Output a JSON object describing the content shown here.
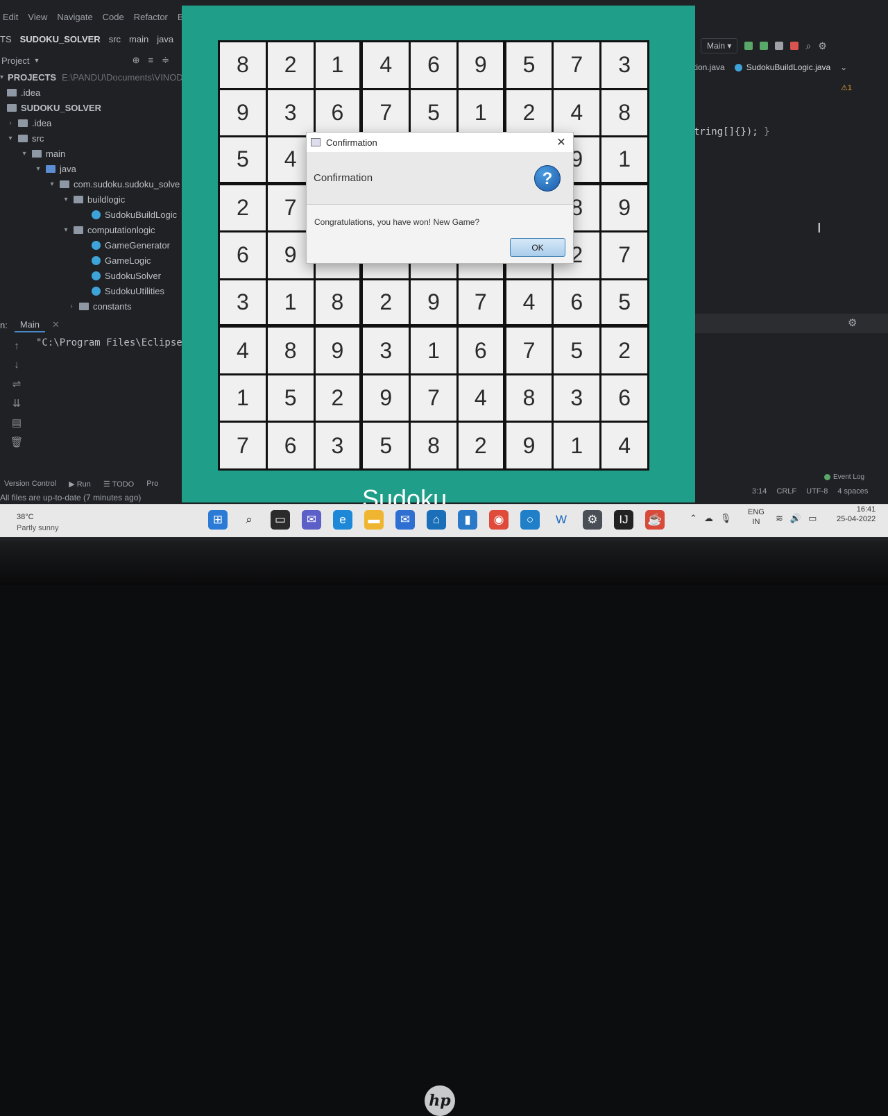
{
  "ide": {
    "menu": [
      "Edit",
      "View",
      "Navigate",
      "Code",
      "Refactor",
      "B"
    ],
    "breadcrumbs": [
      "TS",
      "SUDOKU_SOLVER",
      "src",
      "main",
      "java"
    ],
    "project_header": "Project",
    "tree": [
      {
        "label": "PROJECTS",
        "extra": "E:\\PANDU\\Documents\\VINOD_",
        "type": "root"
      },
      {
        "label": ".idea",
        "type": "folder"
      },
      {
        "label": "SUDOKU_SOLVER",
        "type": "folder"
      },
      {
        "label": ".idea",
        "type": "folder"
      },
      {
        "label": "src",
        "type": "folder"
      },
      {
        "label": "main",
        "type": "folder"
      },
      {
        "label": "java",
        "type": "folder-blue"
      },
      {
        "label": "com.sudoku.sudoku_solve",
        "type": "package"
      },
      {
        "label": "buildlogic",
        "type": "package"
      },
      {
        "label": "SudokuBuildLogic",
        "type": "class"
      },
      {
        "label": "computationlogic",
        "type": "package"
      },
      {
        "label": "GameGenerator",
        "type": "class"
      },
      {
        "label": "GameLogic",
        "type": "class"
      },
      {
        "label": "SudokuSolver",
        "type": "class"
      },
      {
        "label": "SudokuUtilities",
        "type": "class"
      },
      {
        "label": "constants",
        "type": "package"
      }
    ],
    "run_label": "n:",
    "run_tab": "Main",
    "console_text": "\"C:\\Program Files\\Eclipse",
    "bottom_tabs": [
      "Version Control",
      "Run",
      "TODO",
      "Pro"
    ],
    "status_left": "All files are up-to-date (7 minutes ago)",
    "run_config": "Main",
    "editor_tabs": [
      "tion.java",
      "SudokuBuildLogic.java"
    ],
    "warning_count": "1",
    "code_text": "tring[]{});",
    "code_brace": "}",
    "event_log": "Event Log",
    "status_right": [
      "3:14",
      "CRLF",
      "UTF-8",
      "4 spaces"
    ]
  },
  "sudoku": {
    "title": "Sudoku",
    "grid": [
      [
        "8",
        "2",
        "1",
        "4",
        "6",
        "9",
        "5",
        "7",
        "3"
      ],
      [
        "9",
        "3",
        "6",
        "7",
        "5",
        "1",
        "2",
        "4",
        "8"
      ],
      [
        "5",
        "4",
        "",
        "",
        "",
        "",
        "",
        "9",
        "1"
      ],
      [
        "2",
        "7",
        "",
        "",
        "",
        "",
        "",
        "8",
        "9"
      ],
      [
        "6",
        "9",
        "",
        "",
        "",
        "",
        "",
        "2",
        "7"
      ],
      [
        "3",
        "1",
        "8",
        "2",
        "9",
        "7",
        "4",
        "6",
        "5"
      ],
      [
        "4",
        "8",
        "9",
        "3",
        "1",
        "6",
        "7",
        "5",
        "2"
      ],
      [
        "1",
        "5",
        "2",
        "9",
        "7",
        "4",
        "8",
        "3",
        "6"
      ],
      [
        "7",
        "6",
        "3",
        "5",
        "8",
        "2",
        "9",
        "1",
        "4"
      ]
    ]
  },
  "dialog": {
    "window_title": "Confirmation",
    "header": "Confirmation",
    "message": "Congratulations, you have won! New Game?",
    "ok_label": "OK",
    "question_glyph": "?",
    "close_glyph": "✕"
  },
  "taskbar": {
    "temperature": "38°C",
    "weather": "Partly sunny",
    "language": "ENG",
    "region": "IN",
    "time": "16:41",
    "date": "25-04-2022"
  },
  "colors": {
    "sudoku_bg": "#1f9f8a",
    "ok_border": "#3c7fb1"
  },
  "brand": "hp"
}
